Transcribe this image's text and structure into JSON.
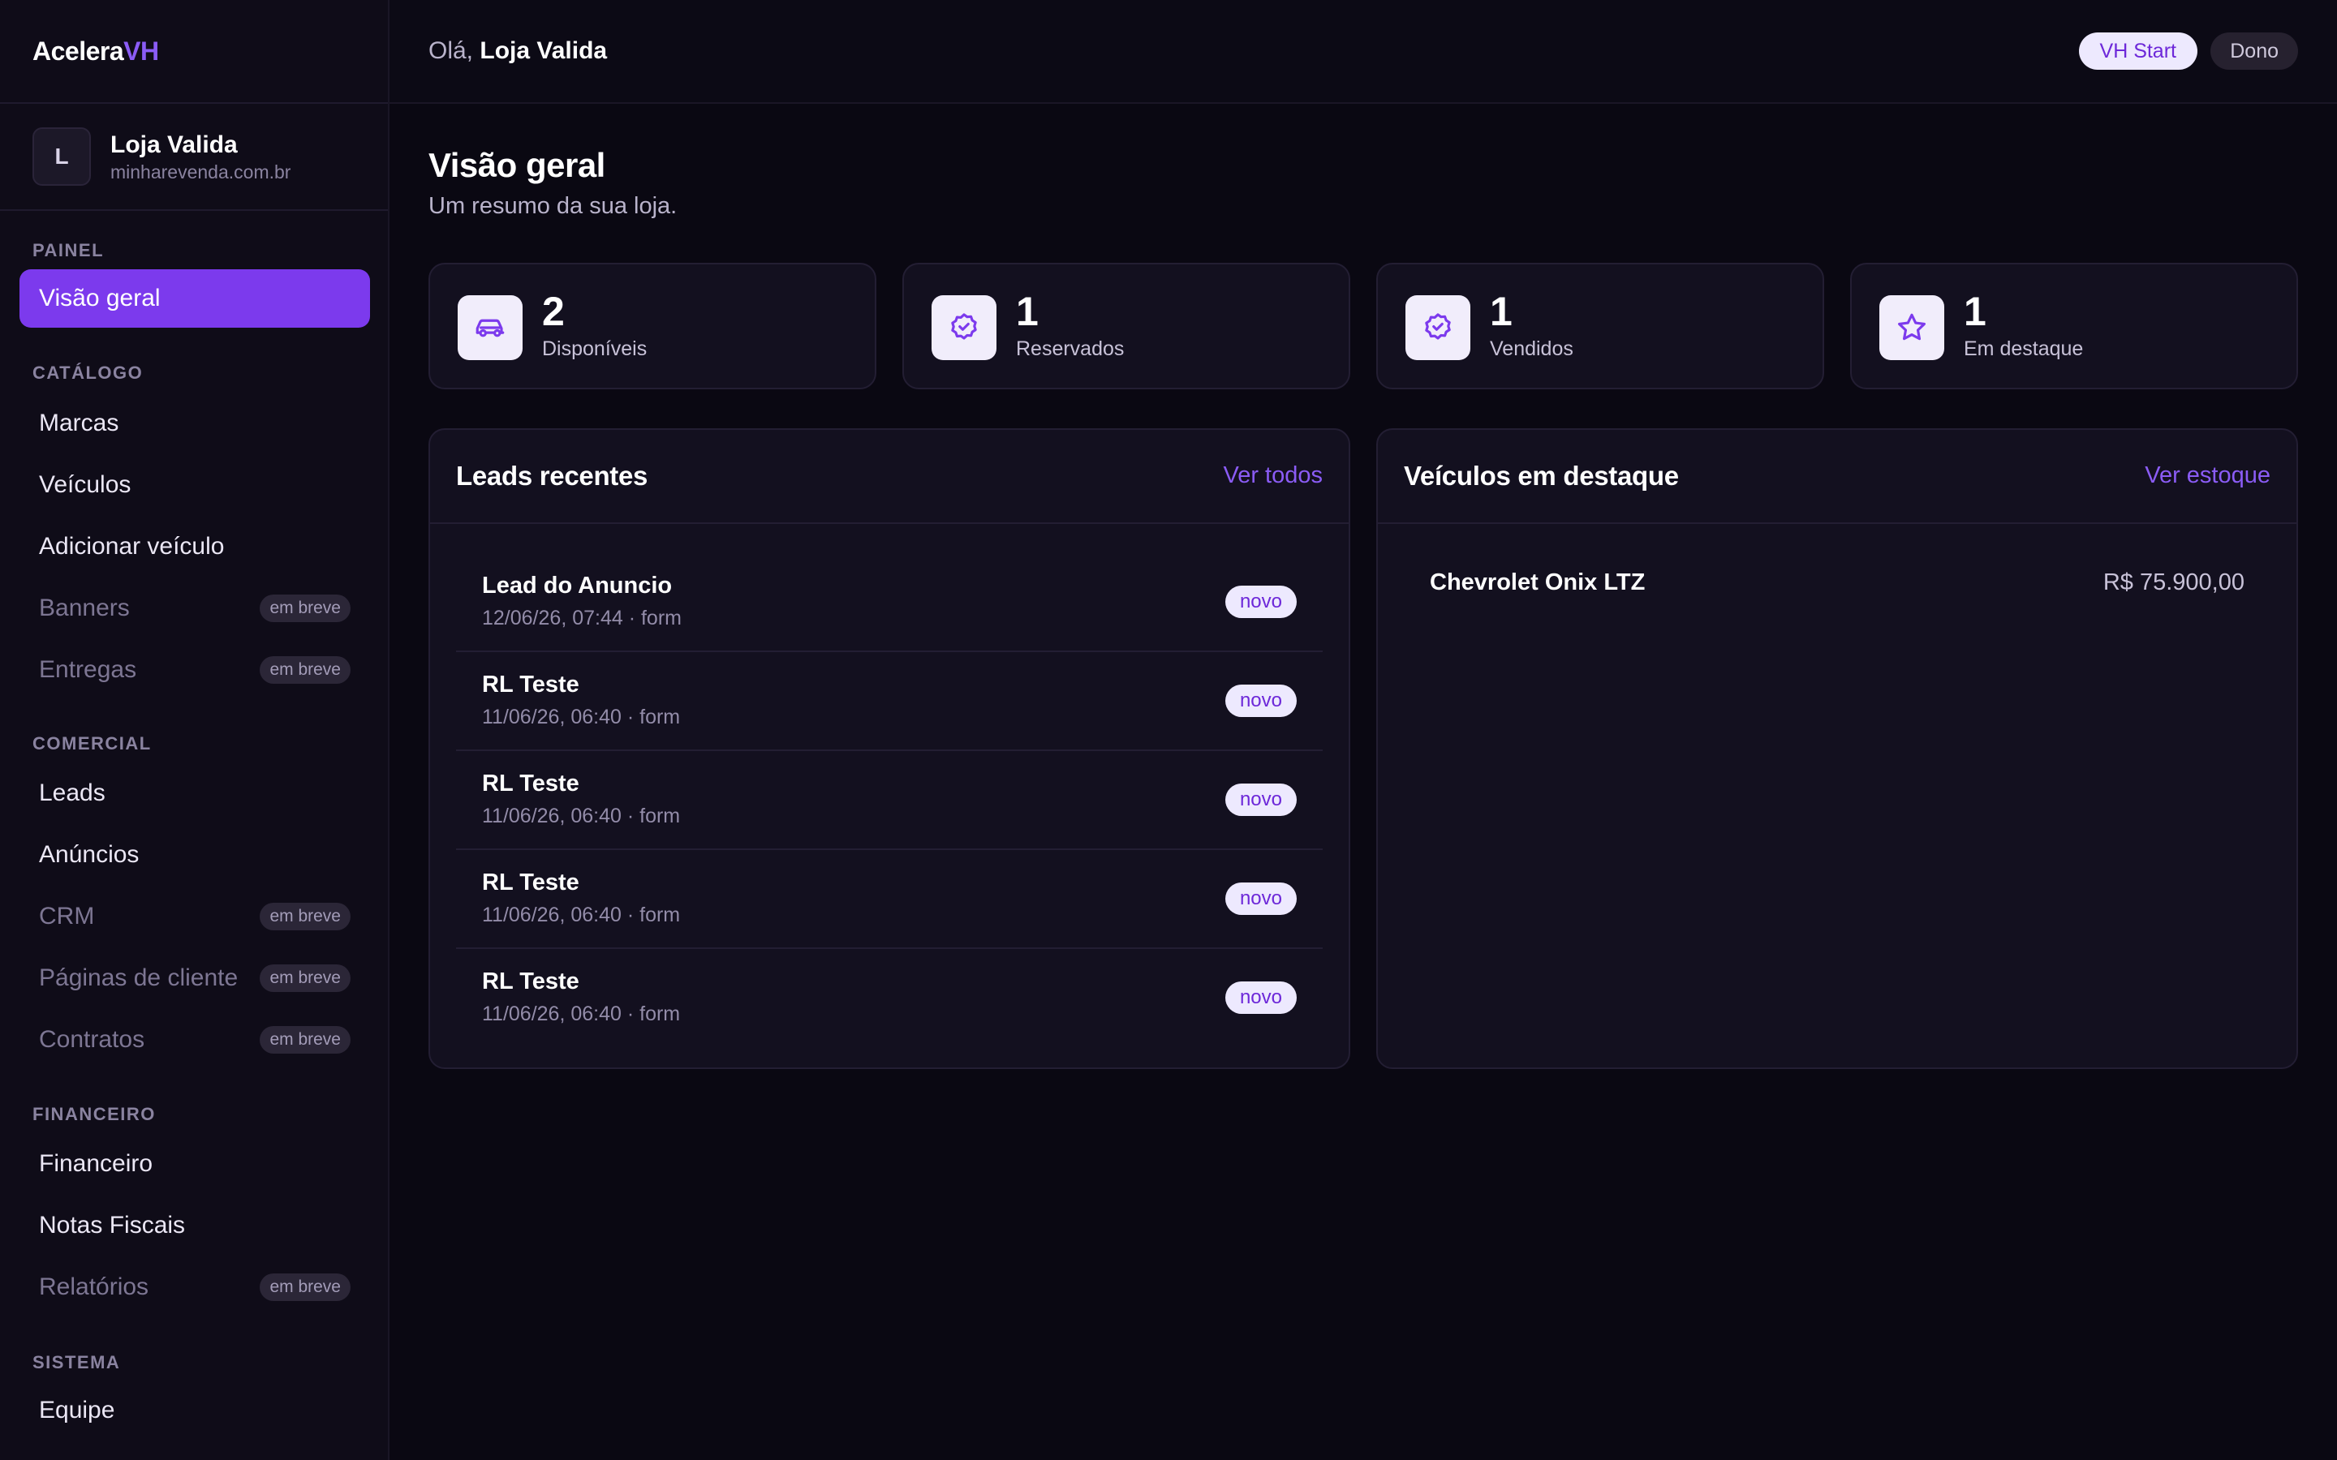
{
  "brand": {
    "part1": "Acelera",
    "part2": "VH"
  },
  "store": {
    "initial": "L",
    "name": "Loja Valida",
    "domain": "minharevenda.com.br"
  },
  "sidebar": {
    "sections": {
      "painel": "PAINEL",
      "catalogo": "CATÁLOGO",
      "comercial": "COMERCIAL",
      "financeiro": "FINANCEIRO",
      "sistema": "SISTEMA"
    },
    "items": {
      "visao_geral": "Visão geral",
      "marcas": "Marcas",
      "veiculos": "Veículos",
      "adicionar_veiculo": "Adicionar veículo",
      "banners": "Banners",
      "entregas": "Entregas",
      "leads": "Leads",
      "anuncios": "Anúncios",
      "crm": "CRM",
      "paginas_cliente": "Páginas de cliente",
      "contratos": "Contratos",
      "financeiro": "Financeiro",
      "notas_fiscais": "Notas Fiscais",
      "relatorios": "Relatórios",
      "equipe": "Equipe"
    },
    "soon_label": "em breve"
  },
  "topbar": {
    "greeting_prefix": "Olá,",
    "greeting_name": "Loja Valida",
    "plan": "VH Start",
    "role": "Dono"
  },
  "page": {
    "title": "Visão geral",
    "subtitle": "Um resumo da sua loja."
  },
  "stats": [
    {
      "value": "2",
      "label": "Disponíveis",
      "icon": "car-icon"
    },
    {
      "value": "1",
      "label": "Reservados",
      "icon": "badge-check-icon"
    },
    {
      "value": "1",
      "label": "Vendidos",
      "icon": "badge-check-icon"
    },
    {
      "value": "1",
      "label": "Em destaque",
      "icon": "star-icon"
    }
  ],
  "leads_panel": {
    "title": "Leads recentes",
    "link": "Ver todos",
    "rows": [
      {
        "name": "Lead do Anuncio",
        "meta": "12/06/26, 07:44 · form",
        "badge": "novo"
      },
      {
        "name": "RL Teste",
        "meta": "11/06/26, 06:40 · form",
        "badge": "novo"
      },
      {
        "name": "RL Teste",
        "meta": "11/06/26, 06:40 · form",
        "badge": "novo"
      },
      {
        "name": "RL Teste",
        "meta": "11/06/26, 06:40 · form",
        "badge": "novo"
      },
      {
        "name": "RL Teste",
        "meta": "11/06/26, 06:40 · form",
        "badge": "novo"
      }
    ]
  },
  "featured_panel": {
    "title": "Veículos em destaque",
    "link": "Ver estoque",
    "vehicles": [
      {
        "name": "Chevrolet Onix LTZ",
        "price": "R$ 75.900,00"
      }
    ]
  },
  "colors": {
    "accent": "#7c3aed",
    "accent_text": "#8b5cf6",
    "background": "#0a0812",
    "card": "#13101f",
    "badge_bg": "#ede9fe"
  }
}
